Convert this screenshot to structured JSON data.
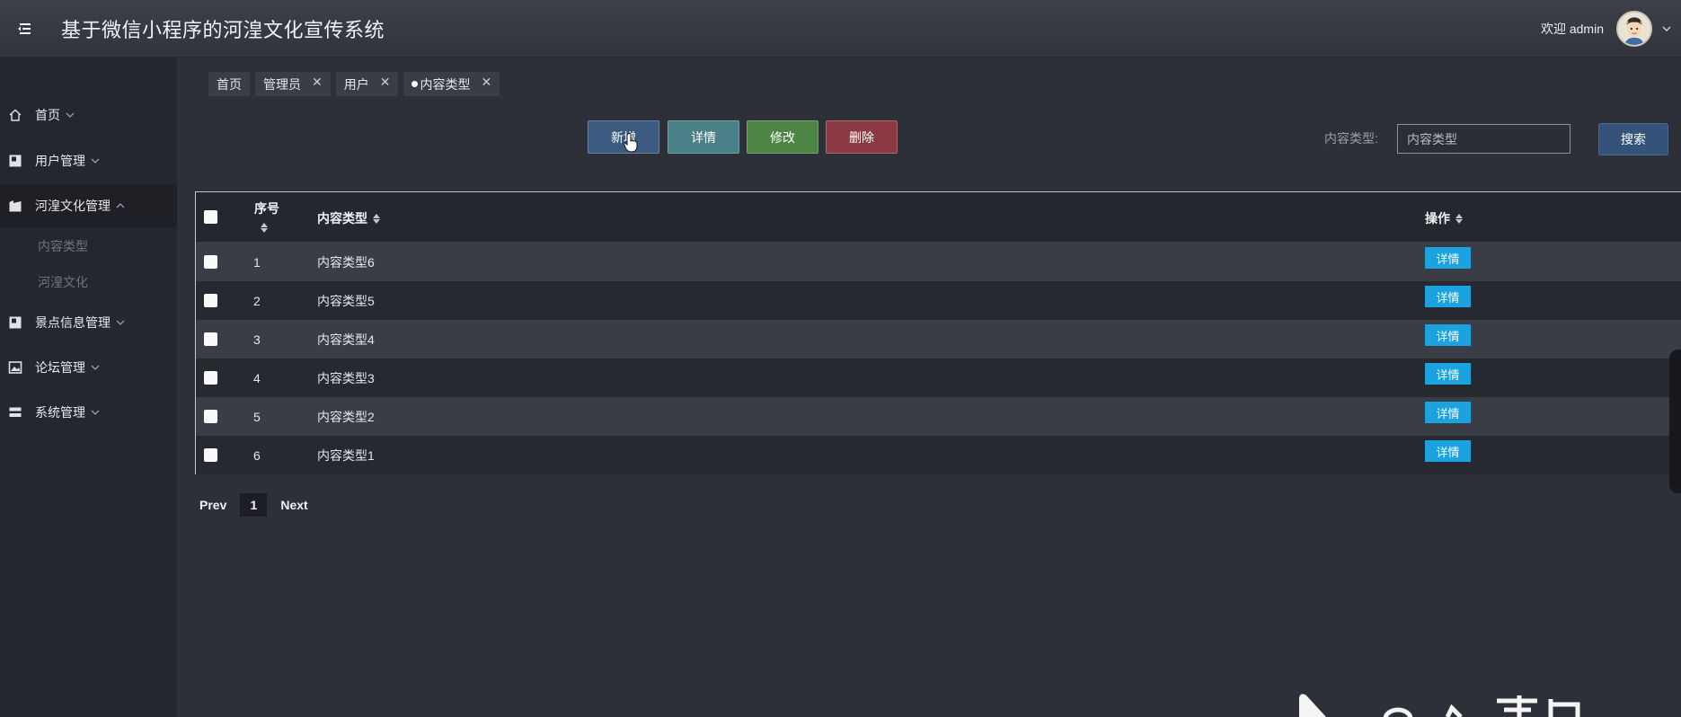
{
  "header": {
    "title": "基于微信小程序的河湟文化宣传系统",
    "welcome": "欢迎 admin"
  },
  "sidebar": {
    "items": [
      {
        "label": "首页",
        "icon": "home-icon"
      },
      {
        "label": "用户管理",
        "icon": "user-card-icon"
      },
      {
        "label": "河湟文化管理",
        "icon": "folder-icon",
        "expanded": true
      },
      {
        "label": "景点信息管理",
        "icon": "user-card-icon"
      },
      {
        "label": "论坛管理",
        "icon": "image-icon"
      },
      {
        "label": "系统管理",
        "icon": "list-icon"
      }
    ],
    "sub_items": [
      "内容类型",
      "河湟文化"
    ]
  },
  "tabs": [
    {
      "label": "首页",
      "closable": false
    },
    {
      "label": "管理员",
      "closable": true
    },
    {
      "label": "用户",
      "closable": true
    },
    {
      "label": "内容类型",
      "closable": true,
      "active": true
    }
  ],
  "toolbar": {
    "add_label": "新增",
    "detail_label": "详情",
    "edit_label": "修改",
    "delete_label": "删除"
  },
  "search": {
    "label": "内容类型:",
    "placeholder": "内容类型",
    "button": "搜索"
  },
  "table": {
    "headers": {
      "index": "序号",
      "type": "内容类型",
      "action": "操作"
    },
    "rows": [
      {
        "index": "1",
        "type": "内容类型6",
        "action": "详情"
      },
      {
        "index": "2",
        "type": "内容类型5",
        "action": "详情"
      },
      {
        "index": "3",
        "type": "内容类型4",
        "action": "详情"
      },
      {
        "index": "4",
        "type": "内容类型3",
        "action": "详情"
      },
      {
        "index": "5",
        "type": "内容类型2",
        "action": "详情"
      },
      {
        "index": "6",
        "type": "内容类型1",
        "action": "详情"
      }
    ]
  },
  "pagination": {
    "prev": "Prev",
    "current": "1",
    "next": "Next"
  },
  "colors": {
    "accent_blue": "#1aa3df",
    "add": "#3a5a80",
    "detail": "#4a8088",
    "edit": "#4d8545",
    "delete": "#8b3942"
  }
}
